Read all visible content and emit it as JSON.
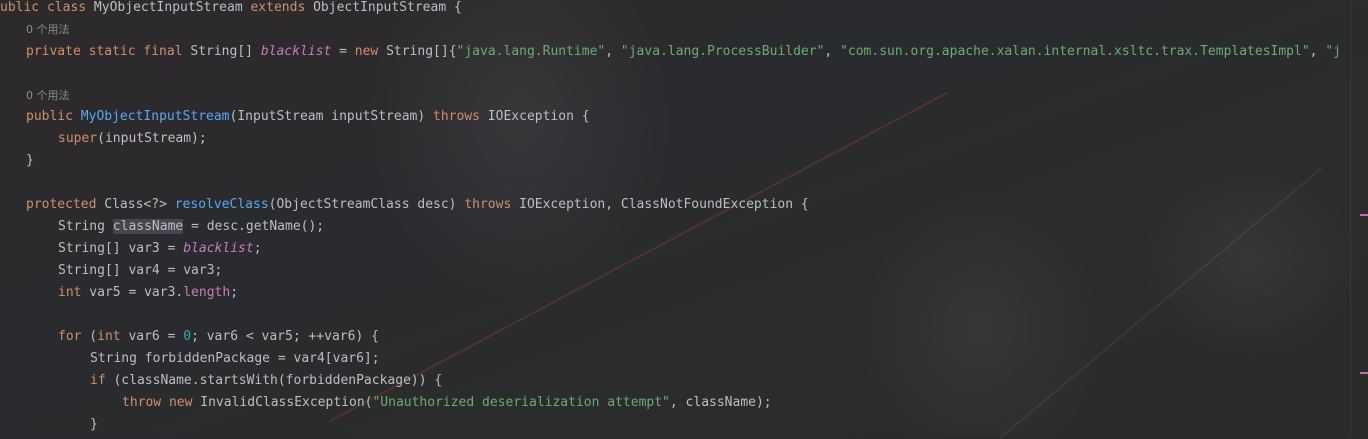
{
  "lines": {
    "l1": {
      "a": "ublic",
      "b": " ",
      "c": "class",
      "d": " MyObjectInputStream ",
      "e": "extends",
      "f": " ObjectInputStream {"
    },
    "hint1": "0 个用法",
    "l2": {
      "a": "private static final",
      "b": " String[] ",
      "c": "blacklist",
      "d": " = ",
      "e": "new",
      "f": " String[]{",
      "g": "\"java.lang.Runtime\"",
      "h": ", ",
      "i": "\"java.lang.ProcessBuilder\"",
      "j": ", ",
      "k": "\"com.sun.org.apache.xalan.internal.xsltc.trax.TemplatesImpl\"",
      "l": ", ",
      "m": "\"j"
    },
    "hint2": "0 个用法",
    "l3": {
      "a": "public",
      "b": " ",
      "c": "MyObjectInputStream",
      "d": "(InputStream inputStream) ",
      "e": "throws",
      "f": " IOException {"
    },
    "l4": {
      "a": "super",
      "b": "(inputStream);"
    },
    "l5": "}",
    "l6": {
      "a": "protected",
      "b": " Class<?> ",
      "c": "resolveClass",
      "d": "(ObjectStreamClass desc) ",
      "e": "throws",
      "f": " IOException, ClassNotFoundException {"
    },
    "l7": {
      "a": "String ",
      "b": "className",
      "c": " = desc.getName();"
    },
    "l8": {
      "a": "String[] var3 = ",
      "b": "blacklist",
      "c": ";"
    },
    "l9": "String[] var4 = var3;",
    "l10": {
      "a": "int",
      "b": " var5 = var3.",
      "c": "length",
      "d": ";"
    },
    "l11": {
      "a": "for",
      "b": " (",
      "c": "int",
      "d": " var6 = ",
      "e": "0",
      "f": "; var6 < var5; ++var6) {"
    },
    "l12": "String forbiddenPackage = var4[var6];",
    "l13": {
      "a": "if",
      "b": " (className.startsWith(forbiddenPackage)) {"
    },
    "l14": {
      "a": "throw",
      "b": " ",
      "c": "new",
      "d": " InvalidClassException(",
      "e": "\"Unauthorized deserialization attempt\"",
      "f": ", className);"
    },
    "l15": "}"
  },
  "colors": {
    "background": "#2a2b2e",
    "keyword": "#cf8e6d",
    "string": "#6aab73",
    "field": "#c77dbb",
    "method_declaration": "#56a8f5",
    "number": "#2aacb8",
    "text": "#bcbec4"
  }
}
